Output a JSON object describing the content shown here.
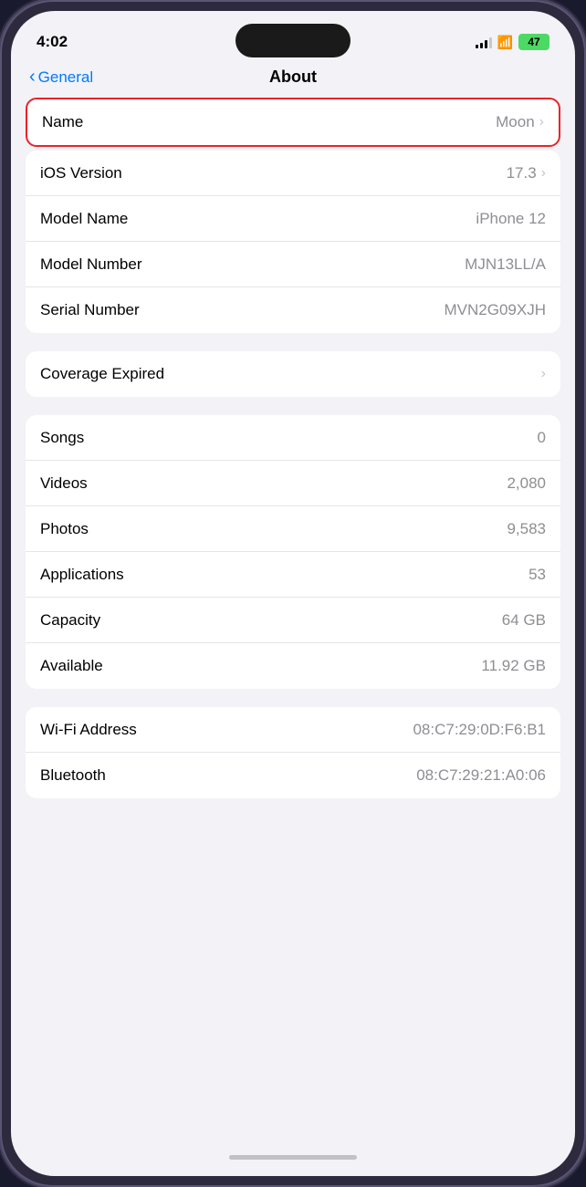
{
  "statusBar": {
    "time": "4:02",
    "battery": "47"
  },
  "header": {
    "backLabel": "General",
    "title": "About"
  },
  "groups": [
    {
      "id": "device-info",
      "highlighted": true,
      "rows": [
        {
          "id": "name",
          "label": "Name",
          "value": "Moon",
          "hasChevron": true,
          "highlight": true
        },
        {
          "id": "ios-version",
          "label": "iOS Version",
          "value": "17.3",
          "hasChevron": true
        },
        {
          "id": "model-name",
          "label": "Model Name",
          "value": "iPhone 12",
          "hasChevron": false
        },
        {
          "id": "model-number",
          "label": "Model Number",
          "value": "MJN13LL/A",
          "hasChevron": false
        },
        {
          "id": "serial-number",
          "label": "Serial Number",
          "value": "MVN2G09XJH",
          "hasChevron": false
        }
      ]
    },
    {
      "id": "coverage",
      "rows": [
        {
          "id": "coverage-expired",
          "label": "Coverage Expired",
          "value": "",
          "hasChevron": true
        }
      ]
    },
    {
      "id": "media",
      "rows": [
        {
          "id": "songs",
          "label": "Songs",
          "value": "0",
          "hasChevron": false
        },
        {
          "id": "videos",
          "label": "Videos",
          "value": "2,080",
          "hasChevron": false
        },
        {
          "id": "photos",
          "label": "Photos",
          "value": "9,583",
          "hasChevron": false
        },
        {
          "id": "applications",
          "label": "Applications",
          "value": "53",
          "hasChevron": false
        },
        {
          "id": "capacity",
          "label": "Capacity",
          "value": "64 GB",
          "hasChevron": false
        },
        {
          "id": "available",
          "label": "Available",
          "value": "11.92 GB",
          "hasChevron": false
        }
      ]
    },
    {
      "id": "network",
      "rows": [
        {
          "id": "wifi-address",
          "label": "Wi-Fi Address",
          "value": "08:C7:29:0D:F6:B1",
          "hasChevron": false
        },
        {
          "id": "bluetooth",
          "label": "Bluetooth",
          "value": "08:C7:29:21:A0:06",
          "hasChevron": false
        }
      ]
    }
  ]
}
